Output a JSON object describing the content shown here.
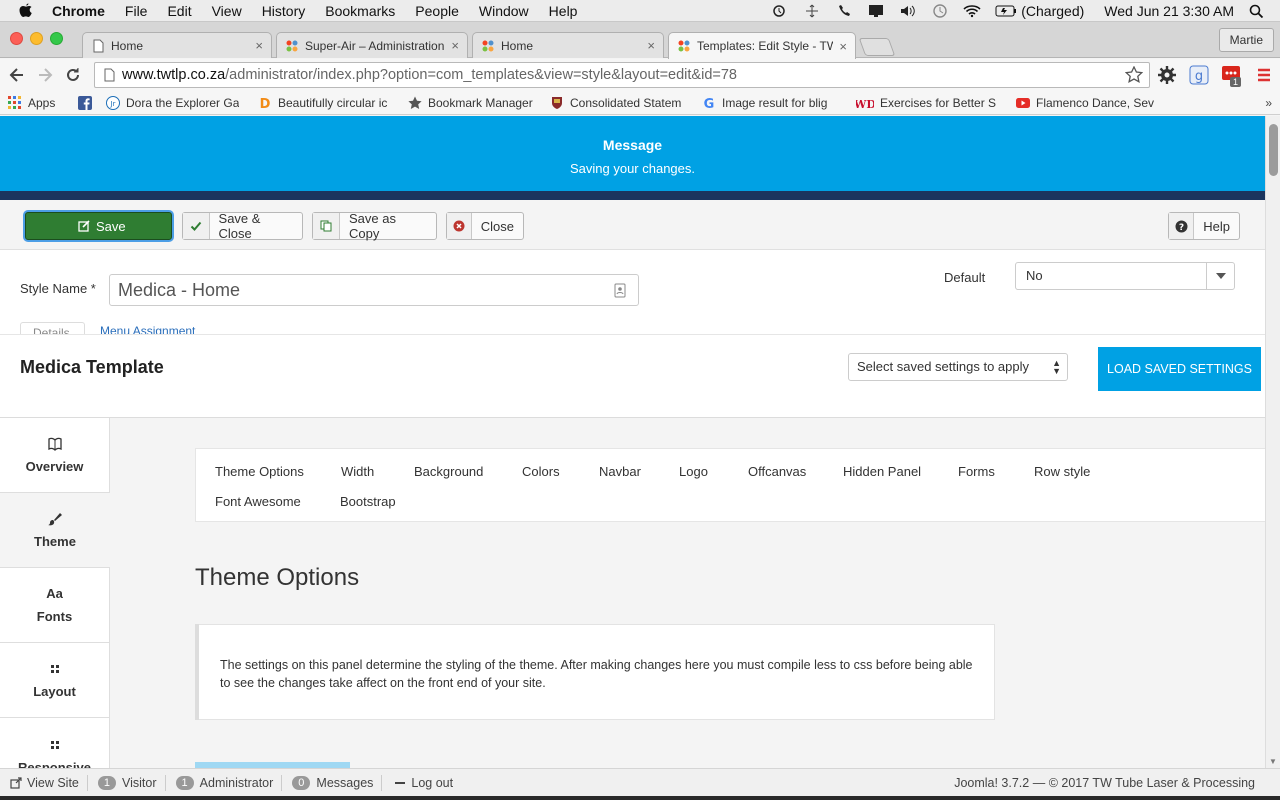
{
  "os_menubar": {
    "app": "Chrome",
    "items": [
      "File",
      "Edit",
      "View",
      "History",
      "Bookmarks",
      "People",
      "Window",
      "Help"
    ],
    "battery": "(Charged)",
    "clock": "Wed Jun 21  3:30 AM"
  },
  "browser": {
    "tabs": [
      {
        "title": "Home",
        "icon": "page-icon"
      },
      {
        "title": "Super-Air – Administration",
        "icon": "joomla-icon"
      },
      {
        "title": "Home",
        "icon": "joomla-icon"
      },
      {
        "title": "Templates: Edit Style - TW",
        "icon": "joomla-icon",
        "active": true
      }
    ],
    "profile": "Martie",
    "url_host": "www.twtlp.co.za",
    "url_path": "/administrator/index.php?option=com_templates&view=style&layout=edit&id=78",
    "extension_badge": "1",
    "bookmarks": [
      {
        "label": "Apps",
        "icon": "apps-grid-icon"
      },
      {
        "label": "",
        "icon": "facebook-icon"
      },
      {
        "label": "Dora the Explorer Ga",
        "icon": "jr-icon"
      },
      {
        "label": "Beautifully circular ic",
        "icon": "d-icon"
      },
      {
        "label": "Bookmark Manager",
        "icon": "star-icon"
      },
      {
        "label": "Consolidated Statem",
        "icon": "crest-icon"
      },
      {
        "label": "Image result for blig",
        "icon": "google-icon"
      },
      {
        "label": "Exercises for Better S",
        "icon": "wd-icon"
      },
      {
        "label": "Flamenco Dance, Sev",
        "icon": "youtube-icon"
      }
    ]
  },
  "alert": {
    "heading": "Message",
    "message": "Saving your changes."
  },
  "actions": {
    "save": "Save",
    "save_close": "Save & Close",
    "save_copy": "Save as Copy",
    "close": "Close",
    "help": "Help"
  },
  "style_form": {
    "style_name_label": "Style Name *",
    "style_name_value": "Medica - Home",
    "default_label": "Default",
    "default_value": "No",
    "tab_details": "Details",
    "tab_menu": "Menu Assignment"
  },
  "template": {
    "title": "Medica Template",
    "saved_settings_placeholder": "Select saved settings to apply",
    "load_button": "LOAD SAVED SETTINGS"
  },
  "sidebar": [
    {
      "label": "Overview",
      "icon": "book-icon",
      "active": false
    },
    {
      "label": "Theme",
      "icon": "brush-icon",
      "active": true
    },
    {
      "label": "Fonts",
      "icon": "font-icon",
      "active": false
    },
    {
      "label": "Layout",
      "icon": "grid-icon",
      "active": false
    },
    {
      "label": "Responsive",
      "icon": "grid-icon",
      "active": false
    }
  ],
  "subtabs": [
    "Theme Options",
    "Width",
    "Background",
    "Colors",
    "Navbar",
    "Logo",
    "Offcanvas",
    "Hidden Panel",
    "Forms",
    "Row style",
    "Font Awesome",
    "Bootstrap"
  ],
  "section": {
    "title": "Theme Options",
    "description": "The settings on this panel determine the styling of the theme. After making changes here you must compile less to css before being able to see the changes take affect on the front end of your site."
  },
  "statusbar": {
    "view_site": "View Site",
    "visitor_count": "1",
    "visitor_label": "Visitor",
    "admin_count": "1",
    "admin_label": "Administrator",
    "messages_count": "0",
    "messages_label": "Messages",
    "logout": "Log out",
    "version": "Joomla! 3.7.2",
    "copyright": "— © 2017 TW Tube Laser & Processing"
  },
  "colors": {
    "accent_blue": "#00a1e4",
    "save_green": "#2f7d32",
    "dark_navy": "#1b355e"
  }
}
